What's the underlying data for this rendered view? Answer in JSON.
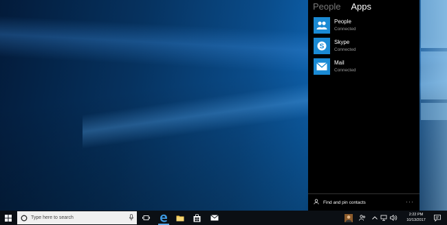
{
  "flyout": {
    "tabs": [
      "People",
      "Apps"
    ],
    "apps": [
      {
        "name": "People",
        "status": "Connected",
        "icon": "people-icon"
      },
      {
        "name": "Skype",
        "status": "Connected",
        "icon": "skype-icon"
      },
      {
        "name": "Mail",
        "status": "Connected",
        "icon": "mail-icon"
      }
    ],
    "find_label": "Find and pin contacts",
    "more_label": "···"
  },
  "taskbar": {
    "search_placeholder": "Type here to search",
    "pinned": [
      "task-view-icon",
      "edge-icon",
      "file-explorer-icon",
      "store-icon",
      "mail-icon"
    ],
    "clock": {
      "time": "2:22 PM",
      "date": "10/13/2017"
    },
    "accent": "#5fa8e6"
  },
  "colors": {
    "tile": "#1a8ad4",
    "flyout_bg": "#000000",
    "taskbar_bg": "#0b0f14"
  }
}
